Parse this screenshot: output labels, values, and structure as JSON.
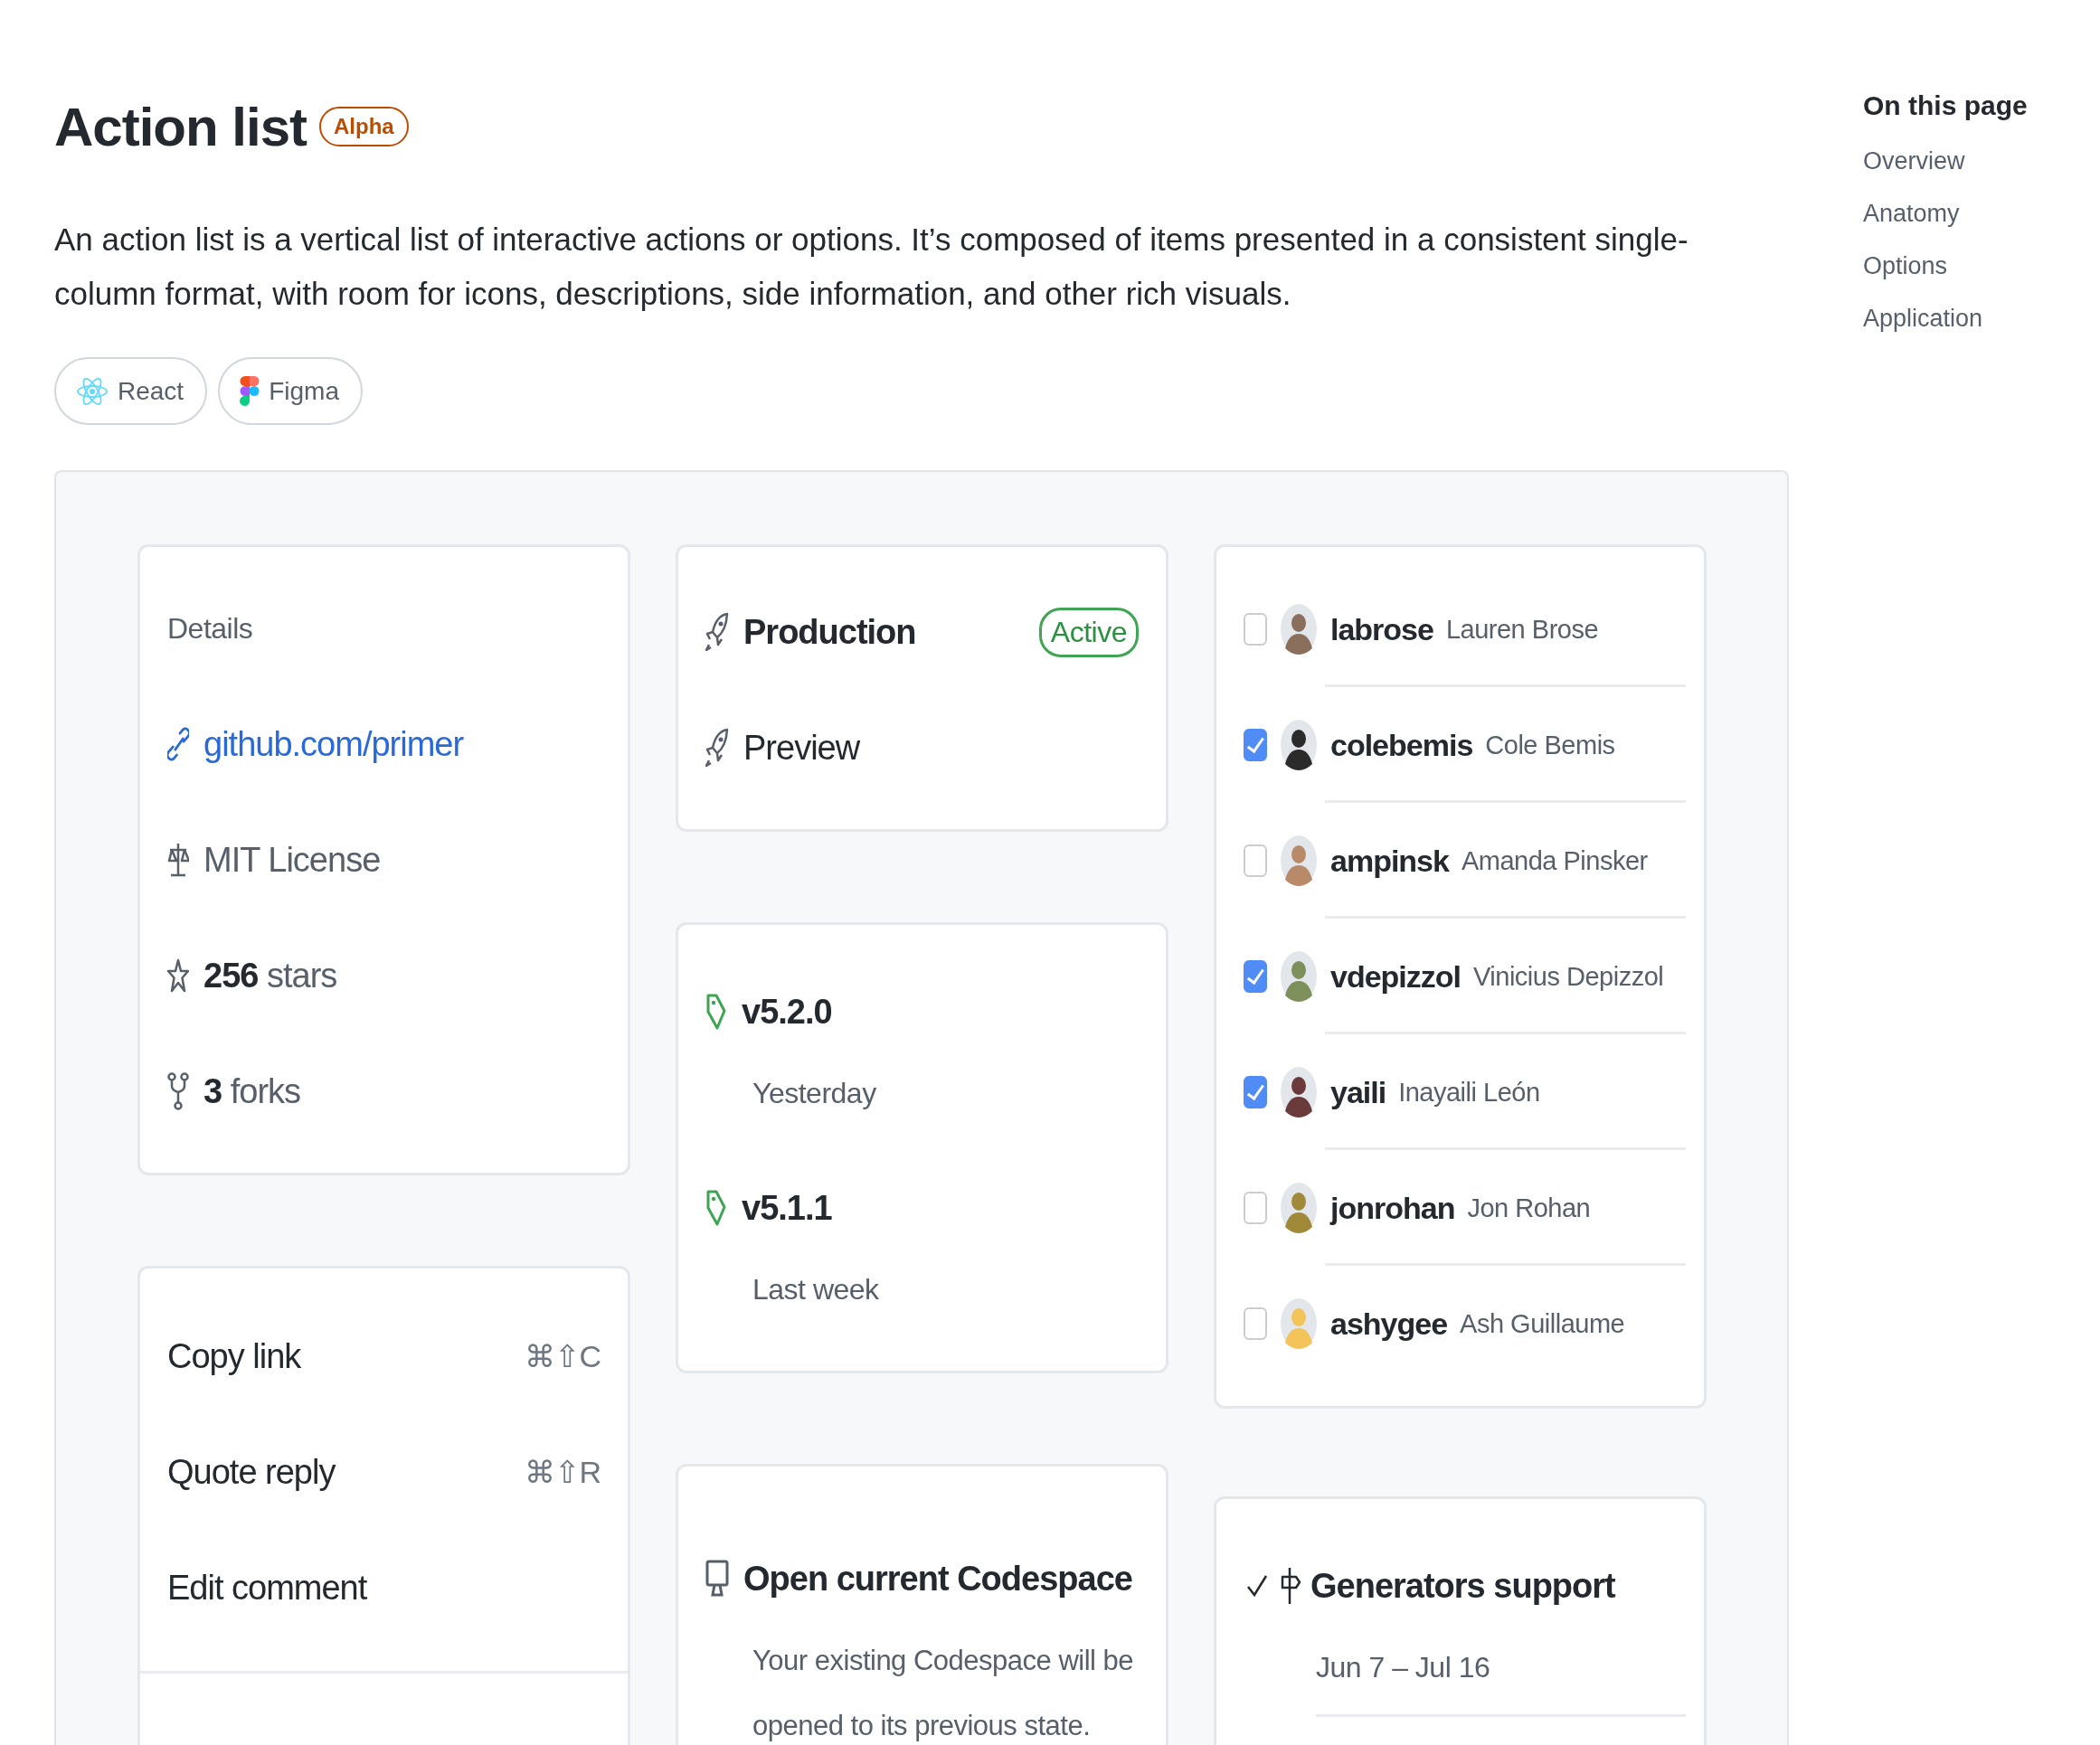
{
  "page": {
    "title": "Action list",
    "badge": "Alpha",
    "description": "An action list is a vertical list of interactive actions or options. It’s composed of items presented in a consistent single-column format, with room for icons, descriptions, side information, and other rich visuals.",
    "links": [
      {
        "kind": "react",
        "label": "React"
      },
      {
        "kind": "figma",
        "label": "Figma"
      }
    ]
  },
  "toc": {
    "heading": "On this page",
    "items": [
      "Overview",
      "Anatomy",
      "Options",
      "Application"
    ]
  },
  "details_card": {
    "heading": "Details",
    "items": [
      {
        "kind": "link",
        "text": "github.com/primer"
      },
      {
        "kind": "license",
        "text": "MIT License"
      },
      {
        "kind": "stars",
        "count": "256",
        "text": "stars"
      },
      {
        "kind": "forks",
        "count": "3",
        "text": "forks"
      }
    ]
  },
  "menu_card": {
    "items": [
      {
        "label": "Copy link",
        "shortcut": "⌘⇧C"
      },
      {
        "label": "Quote reply",
        "shortcut": "⌘⇧R"
      },
      {
        "label": "Edit comment"
      }
    ]
  },
  "environments_card": {
    "items": [
      {
        "label": "Production",
        "badge": "Active"
      },
      {
        "label": "Preview"
      }
    ]
  },
  "releases_card": {
    "items": [
      {
        "version": "v5.2.0",
        "date": "Yesterday"
      },
      {
        "version": "v5.1.1",
        "date": "Last week"
      }
    ]
  },
  "codespace_card": {
    "title": "Open current Codespace",
    "description": "Your existing Codespace will be opened to its previous state."
  },
  "users_card": {
    "items": [
      {
        "login": "labrose",
        "name": "Lauren Brose",
        "checked": false
      },
      {
        "login": "colebemis",
        "name": "Cole Bemis",
        "checked": true
      },
      {
        "login": "ampinsk",
        "name": "Amanda Pinsker",
        "checked": false
      },
      {
        "login": "vdepizzol",
        "name": "Vinicius Depizzol",
        "checked": true
      },
      {
        "login": "yaili",
        "name": "Inayaili León",
        "checked": true
      },
      {
        "login": "jonrohan",
        "name": "Jon Rohan",
        "checked": false
      },
      {
        "login": "ashygee",
        "name": "Ash Guillaume",
        "checked": false
      }
    ]
  },
  "milestone_card": {
    "selected": true,
    "title": "Generators support",
    "date": "Jun 7 – Jul 16"
  }
}
